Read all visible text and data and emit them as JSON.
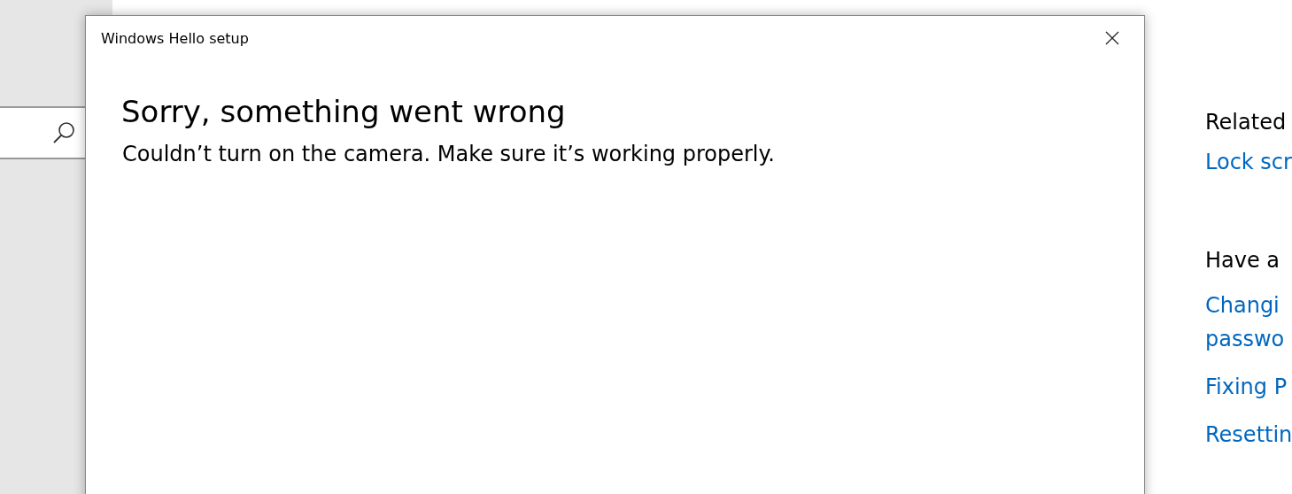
{
  "dialog": {
    "title": "Windows Hello setup",
    "heading": "Sorry, something went wrong",
    "message": "Couldn’t turn on the camera. Make sure it’s working properly."
  },
  "related": {
    "heading": "Related",
    "links": [
      "Lock scr"
    ]
  },
  "help": {
    "heading": "Have a",
    "links": [
      [
        "Changi",
        "passwo"
      ],
      [
        "Fixing P"
      ],
      [
        "Resettin"
      ]
    ]
  }
}
